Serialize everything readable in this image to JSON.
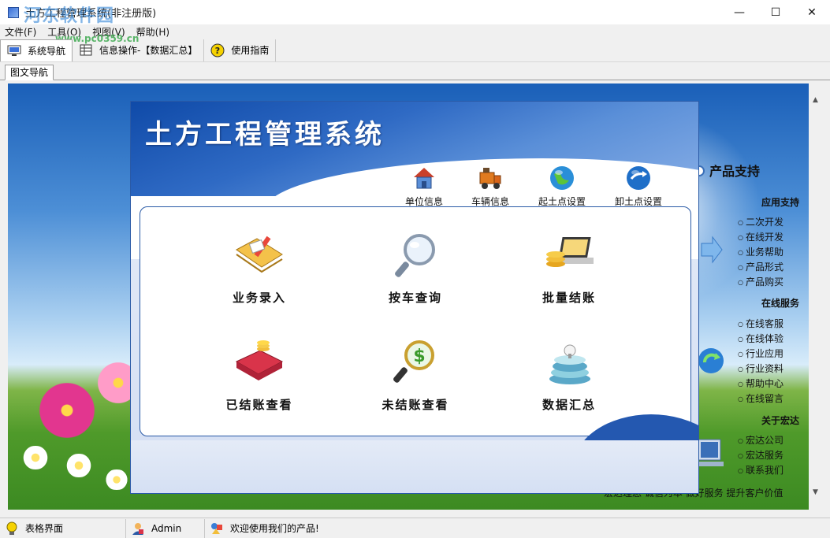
{
  "window": {
    "title": "土方工程管理系统(非注册版)",
    "watermark": "河东软件园",
    "watermark_url": "www.pc0359.cn",
    "minimize": "—",
    "maximize": "☐",
    "close": "✕"
  },
  "menu": [
    {
      "label": "文件(F)"
    },
    {
      "label": "工具(O)"
    },
    {
      "label": "视图(V)"
    },
    {
      "label": "帮助(H)"
    }
  ],
  "toolbar": [
    {
      "label": "系统导航",
      "icon": "monitor-icon"
    },
    {
      "label": "信息操作-【数据汇总】",
      "icon": "table-icon"
    },
    {
      "label": "使用指南",
      "icon": "help-icon"
    }
  ],
  "tab": {
    "label": "图文导航"
  },
  "panel": {
    "title": "土方工程管理系统",
    "top_actions": [
      {
        "label": "单位信息",
        "icon": "house-icon"
      },
      {
        "label": "车辆信息",
        "icon": "truck-icon"
      },
      {
        "label": "起土点设置",
        "icon": "globe-icon"
      },
      {
        "label": "卸土点设置",
        "icon": "globe-arrow-icon"
      }
    ],
    "main_actions": [
      {
        "label": "业务录入",
        "icon": "folder-pen-icon"
      },
      {
        "label": "按车查询",
        "icon": "magnifier-icon"
      },
      {
        "label": "批量结账",
        "icon": "coins-laptop-icon"
      },
      {
        "label": "已结账查看",
        "icon": "ledger-coins-icon"
      },
      {
        "label": "未结账查看",
        "icon": "dollar-magnifier-icon"
      },
      {
        "label": "数据汇总",
        "icon": "book-stack-icon"
      }
    ]
  },
  "right_panel": {
    "header": "产品支持",
    "sections": [
      {
        "title": "应用支持",
        "links": [
          "二次开发",
          "在线开发",
          "业务帮助",
          "产品形式",
          "产品购买"
        ]
      },
      {
        "title": "在线服务",
        "links": [
          "在线客服",
          "在线体验",
          "行业应用",
          "行业资料",
          "帮助中心",
          "在线留言"
        ]
      },
      {
        "title": "关于宏达",
        "links": [
          "宏达公司",
          "宏达服务",
          "联系我们"
        ]
      }
    ],
    "slogan": "宏达理念 诚信为本 做好服务 提升客户价值"
  },
  "status": [
    {
      "label": "表格界面",
      "icon": "bulb-icon"
    },
    {
      "label": "Admin",
      "icon": "user-icon"
    },
    {
      "label": "欢迎使用我们的产品!",
      "icon": "shapes-icon"
    }
  ],
  "colors": {
    "panel_blue": "#2a5aa6",
    "title_white": "#ffffff"
  }
}
